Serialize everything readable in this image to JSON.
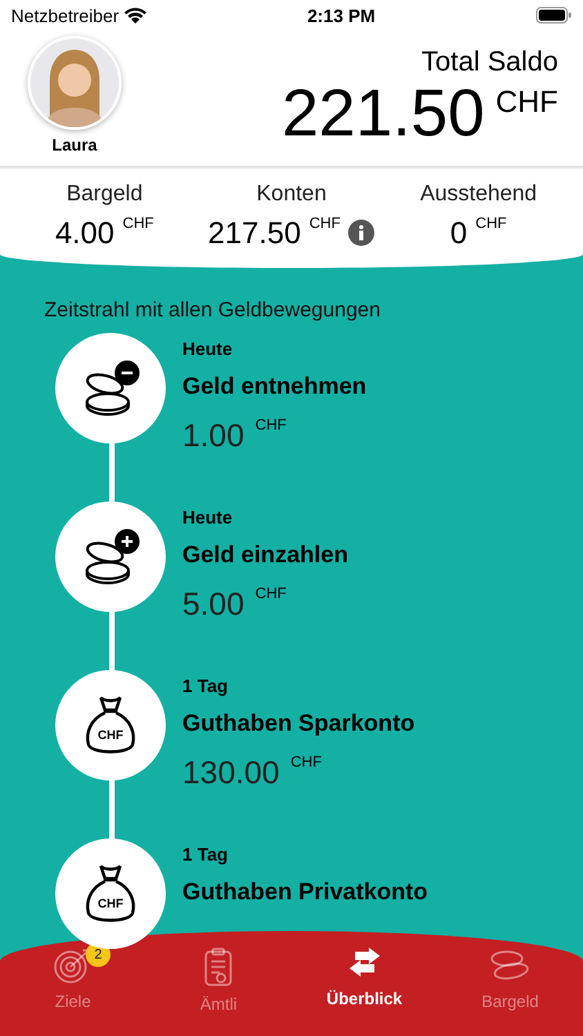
{
  "status_bar": {
    "carrier": "Netzbetreiber",
    "time": "2:13 PM"
  },
  "profile": {
    "name": "Laura"
  },
  "total": {
    "label": "Total Saldo",
    "amount": "221.50",
    "currency": "CHF"
  },
  "summary": [
    {
      "label": "Bargeld",
      "amount": "4.00",
      "currency": "CHF",
      "info": false
    },
    {
      "label": "Konten",
      "amount": "217.50",
      "currency": "CHF",
      "info": true
    },
    {
      "label": "Ausstehend",
      "amount": "0",
      "currency": "CHF",
      "info": false
    }
  ],
  "timeline": {
    "title": "Zeitstrahl mit allen Geldbewegungen",
    "items": [
      {
        "kind": "withdraw",
        "date": "Heute",
        "title": "Geld entnehmen",
        "amount": "1.00",
        "currency": "CHF"
      },
      {
        "kind": "deposit",
        "date": "Heute",
        "title": "Geld einzahlen",
        "amount": "5.00",
        "currency": "CHF"
      },
      {
        "kind": "balance",
        "icon_label": "CHF",
        "date": "1 Tag",
        "title": "Guthaben Sparkonto",
        "amount": "130.00",
        "currency": "CHF"
      },
      {
        "kind": "balance",
        "icon_label": "CHF",
        "date": "1 Tag",
        "title": "Guthaben Privatkonto"
      }
    ]
  },
  "tab_bar": [
    {
      "kind": "target",
      "label": "Ziele",
      "badge": "2",
      "selected": false
    },
    {
      "kind": "clipboard",
      "label": "Ämtli",
      "selected": false
    },
    {
      "kind": "transfer",
      "label": "Überblick",
      "selected": true
    },
    {
      "kind": "coins",
      "label": "Bargeld",
      "selected": false
    }
  ]
}
